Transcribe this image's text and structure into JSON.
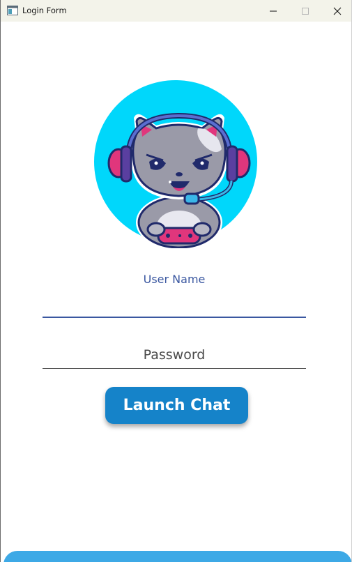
{
  "window": {
    "title": "Login Form",
    "minimize_glyph": "—",
    "maximize_glyph": "□",
    "close_glyph": "✕"
  },
  "avatar": {
    "icon": "gamer-cat-mascot",
    "background": "#00d7fb"
  },
  "form": {
    "username_label": "User Name",
    "username_value": "",
    "password_placeholder": "Password",
    "password_value": "",
    "launch_label": "Launch Chat"
  },
  "colors": {
    "accent": "#1583c9",
    "label": "#3a57a0",
    "footer": "#3da9e6"
  }
}
